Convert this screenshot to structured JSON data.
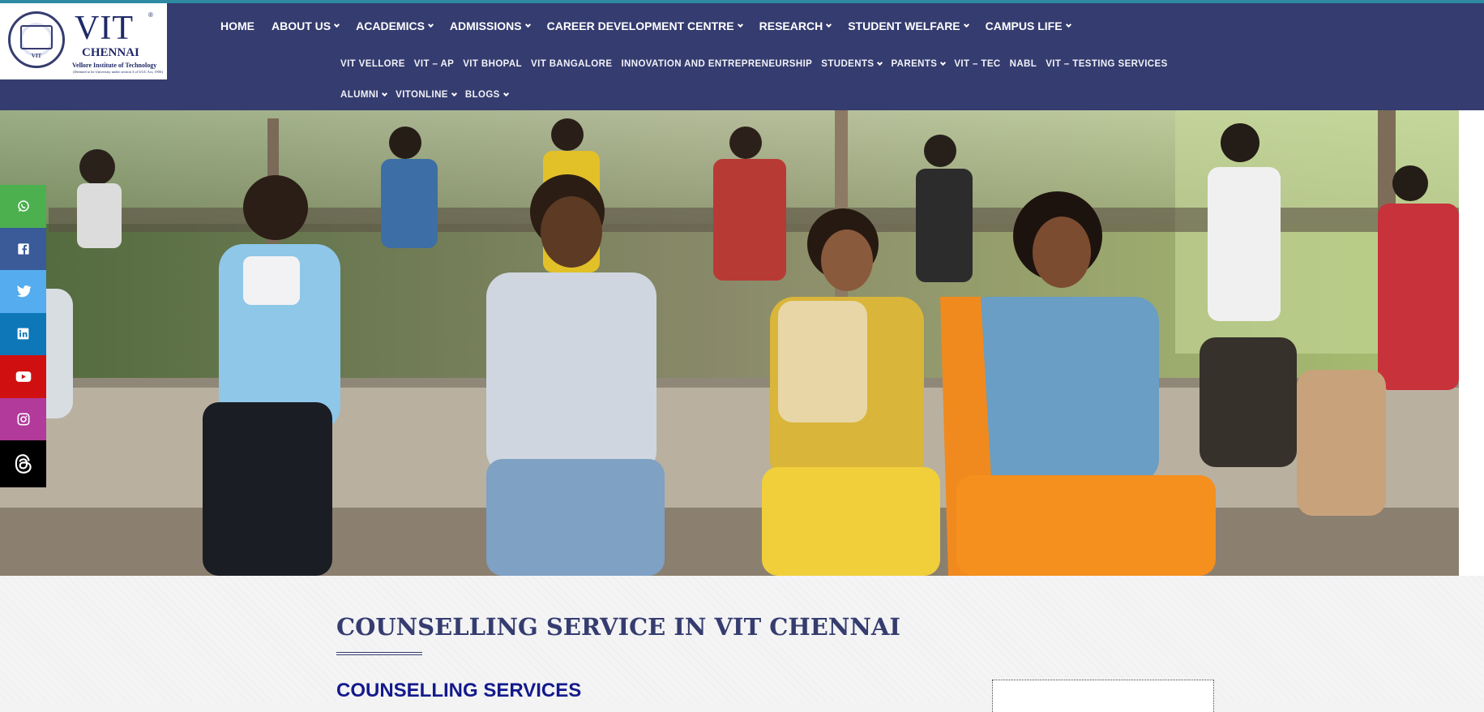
{
  "logo": {
    "main": "VIT",
    "registered": "®",
    "city": "CHENNAI",
    "full_name": "Vellore Institute of Technology",
    "subtitle": "(Deemed to be University under section 3 of UGC Act, 1956)",
    "seal_text": "VIT"
  },
  "nav": {
    "main": [
      {
        "label": "HOME",
        "dropdown": false
      },
      {
        "label": "ABOUT US",
        "dropdown": true
      },
      {
        "label": "ACADEMICS",
        "dropdown": true
      },
      {
        "label": "ADMISSIONS",
        "dropdown": true
      },
      {
        "label": "CAREER DEVELOPMENT CENTRE",
        "dropdown": true
      },
      {
        "label": "RESEARCH",
        "dropdown": true
      },
      {
        "label": "STUDENT WELFARE",
        "dropdown": true
      },
      {
        "label": "CAMPUS LIFE",
        "dropdown": true
      }
    ],
    "secondary": [
      {
        "label": "VIT VELLORE",
        "dropdown": false
      },
      {
        "label": "VIT – AP",
        "dropdown": false
      },
      {
        "label": "VIT BHOPAL",
        "dropdown": false
      },
      {
        "label": "VIT BANGALORE",
        "dropdown": false
      },
      {
        "label": "INNOVATION AND ENTREPRENEURSHIP",
        "dropdown": false
      },
      {
        "label": "STUDENTS",
        "dropdown": true
      },
      {
        "label": "PARENTS",
        "dropdown": true
      },
      {
        "label": "VIT – TEC",
        "dropdown": false
      },
      {
        "label": "NABL",
        "dropdown": false
      },
      {
        "label": "VIT – TESTING SERVICES",
        "dropdown": false
      }
    ],
    "tertiary": [
      {
        "label": "ALUMNI",
        "dropdown": true
      },
      {
        "label": "VITONLINE",
        "dropdown": true
      },
      {
        "label": "BLOGS",
        "dropdown": true
      }
    ]
  },
  "social": [
    {
      "icon": "whatsapp-icon",
      "color": "#4cb04f"
    },
    {
      "icon": "facebook-icon",
      "color": "#3a5a98"
    },
    {
      "icon": "twitter-icon",
      "color": "#55acee"
    },
    {
      "icon": "linkedin-icon",
      "color": "#0d77b7"
    },
    {
      "icon": "youtube-icon",
      "color": "#d01010"
    },
    {
      "icon": "instagram-icon",
      "color": "#b13a9b"
    },
    {
      "icon": "threads-icon",
      "color": "#000000"
    }
  ],
  "colors": {
    "header_bg": "#353c6f",
    "top_stripe": "#2d8aa0",
    "title": "#353c6f",
    "section_heading": "#131a8c"
  },
  "content": {
    "page_title": "COUNSELLING SERVICE IN VIT CHENNAI",
    "section_heading": "COUNSELLING SERVICES"
  }
}
